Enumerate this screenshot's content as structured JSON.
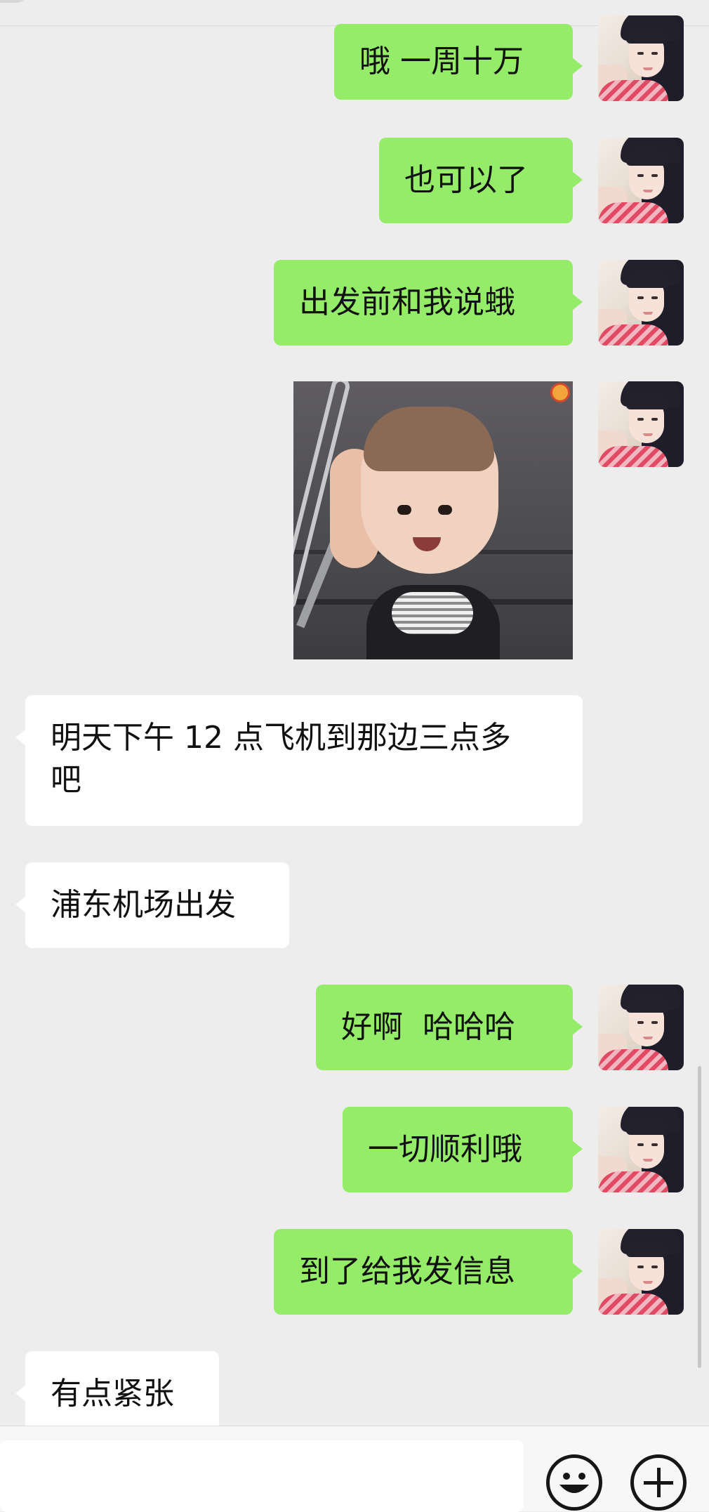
{
  "messages": [
    {
      "side": "me",
      "text": "哦 一周十万"
    },
    {
      "side": "me",
      "text": "也可以了"
    },
    {
      "side": "me",
      "text": "出发前和我说蛾"
    },
    {
      "side": "me",
      "type": "sticker",
      "icon": "baby-peeking-sticker"
    },
    {
      "side": "other",
      "text": "明天下午 12 点飞机到那边三点多\n吧"
    },
    {
      "side": "other",
      "text": "浦东机场出发"
    },
    {
      "side": "me",
      "text": "好啊  哈哈哈"
    },
    {
      "side": "me",
      "text": "一切顺利哦"
    },
    {
      "side": "me",
      "text": "到了给我发信息"
    },
    {
      "side": "other",
      "text": "有点紧张"
    }
  ],
  "input_bar": {
    "value": "",
    "emoji_icon": "smiley-face-icon",
    "plus_icon": "plus-icon"
  },
  "colors": {
    "background": "#ededed",
    "my_bubble": "#95ec69",
    "other_bubble": "#ffffff"
  }
}
